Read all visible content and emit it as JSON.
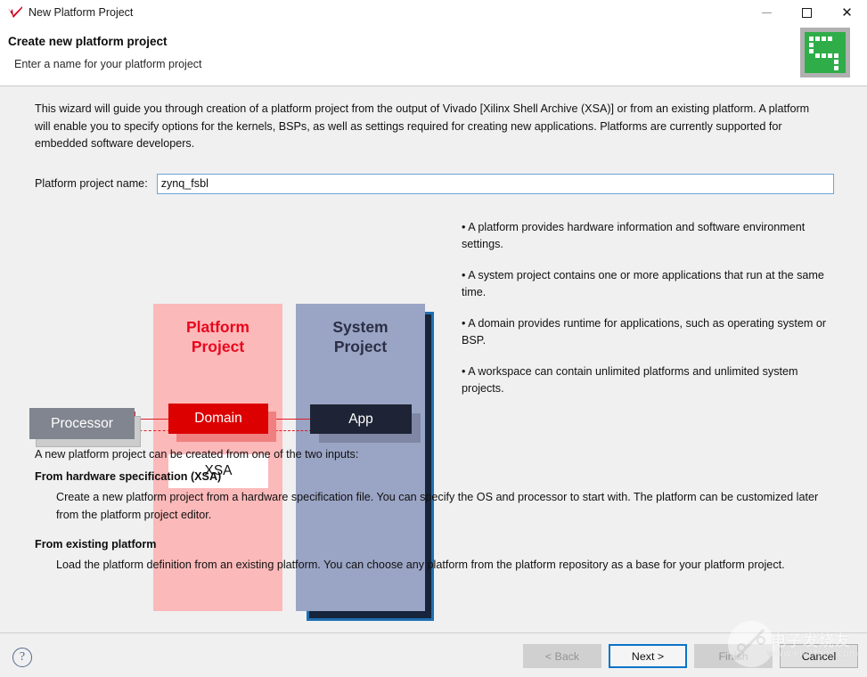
{
  "window": {
    "title": "New Platform Project",
    "icon": "vitis-check-icon",
    "controls": {
      "minimize": "minimize-icon",
      "maximize": "maximize-icon",
      "close": "close-icon"
    }
  },
  "header": {
    "title": "Create new platform project",
    "subtitle": "Enter a name for your platform project",
    "logo": "vitis-green-logo"
  },
  "intro": "This wizard will guide you through creation of a platform project from the output of Vivado [Xilinx Shell Archive (XSA)] or from an existing platform. A platform will enable you to specify options for the kernels, BSPs, as well as settings required for creating new applications. Platforms are currently supported for embedded software developers.",
  "project_name": {
    "label": "Platform project name:",
    "value": "zynq_fsbl",
    "placeholder": ""
  },
  "diagram": {
    "platform_project_title": "Platform\nProject",
    "platform_project_line1": "Platform",
    "platform_project_line2": "Project",
    "system_project_line1": "System",
    "system_project_line2": "Project",
    "processor": "Processor",
    "domain": "Domain",
    "xsa": "XSA",
    "app": "App",
    "colors": {
      "platform_bg": "#fcb9b9",
      "platform_text": "#e8071e",
      "system_bg": "#9aa4c4",
      "system_text": "#2b2f45",
      "domain_bg": "#dc0000",
      "app_bg": "#1e2435",
      "processor_bg": "#808590",
      "xsa_bg": "#ffffff",
      "connector": "#e01b24",
      "system_outline": "#1f6fb2"
    }
  },
  "bullets": [
    "• A platform provides hardware information and software environment settings.",
    "• A system project contains one or more applications that run at the same time.",
    "• A domain provides runtime for applications, such as operating system or BSP.",
    "• A workspace can contain unlimited platforms and unlimited system projects."
  ],
  "lower": {
    "intro": "A new platform project can be created from one of the two inputs:",
    "sections": [
      {
        "heading": "From hardware specification (XSA)",
        "body": "Create a new platform project from a hardware specification file. You can specify the OS and processor to start with. The platform can be customized later from the platform project editor."
      },
      {
        "heading": "From existing platform",
        "body": "Load the platform definition from an existing platform. You can choose any platform from the platform repository as a base for your platform project."
      }
    ]
  },
  "footer": {
    "help_icon": "help-question-icon",
    "buttons": [
      {
        "label": "< Back",
        "state": "disabled"
      },
      {
        "label": "Next >",
        "state": "default"
      },
      {
        "label": "Finish",
        "state": "disabled"
      },
      {
        "label": "Cancel",
        "state": "normal"
      }
    ]
  },
  "watermark": {
    "text_cn": "电子发烧友",
    "text_url": "www.elecfans.com"
  }
}
